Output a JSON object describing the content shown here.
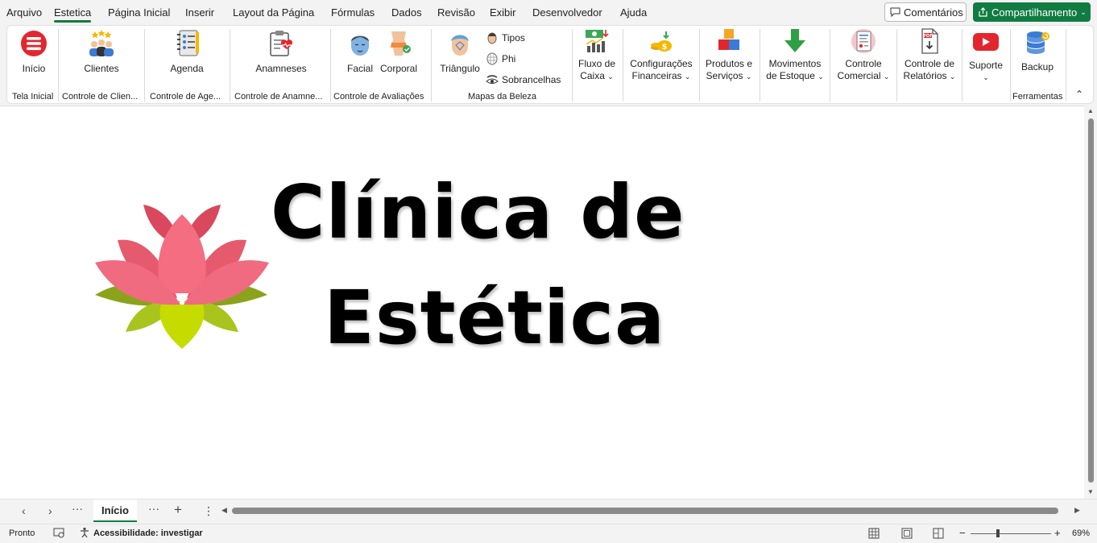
{
  "menu": {
    "tabs": [
      "Arquivo",
      "Estetica",
      "Página Inicial",
      "Inserir",
      "Layout da Página",
      "Fórmulas",
      "Dados",
      "Revisão",
      "Exibir",
      "Desenvolvedor",
      "Ajuda"
    ],
    "active": "Estetica",
    "comments_label": "Comentários",
    "share_label": "Compartilhamento"
  },
  "ribbon": {
    "buttons": {
      "inicio": "Início",
      "clientes": "Clientes",
      "agenda": "Agenda",
      "anamneses": "Anamneses",
      "facial": "Facial",
      "corporal": "Corporal",
      "triangulo": "Triângulo",
      "tipos": "Tipos",
      "phi": "Phi",
      "sobrancelhas": "Sobrancelhas",
      "fluxo_1": "Fluxo de",
      "fluxo_2": "Caixa",
      "config_1": "Configurações",
      "config_2": "Financeiras",
      "produtos_1": "Produtos e",
      "produtos_2": "Serviços",
      "movimentos_1": "Movimentos",
      "movimentos_2": "de Estoque",
      "comercial_1": "Controle",
      "comercial_2": "Comercial",
      "relatorios_1": "Controle de",
      "relatorios_2": "Relatórios",
      "suporte": "Suporte",
      "backup": "Backup"
    },
    "groups": {
      "tela_inicial": "Tela Inicial",
      "clientes": "Controle de Clien...",
      "agenda": "Controle de Age...",
      "anamneses": "Controle de Anamne...",
      "avaliacoes": "Controle de Avaliações",
      "mapas": "Mapas da Beleza",
      "ferramentas": "Ferramentas"
    }
  },
  "sheet": {
    "title_line1": "Clínica de",
    "title_line2": "Estética",
    "logo": "lotus-flower-logo"
  },
  "tabs": {
    "active_sheet": "Início"
  },
  "status": {
    "ready": "Pronto",
    "accessibility": "Acessibilidade: investigar",
    "zoom": "69%"
  },
  "colors": {
    "accent": "#107c41",
    "lotus_pink": "#f06b7f",
    "lotus_leaf": "#a8c41d"
  }
}
